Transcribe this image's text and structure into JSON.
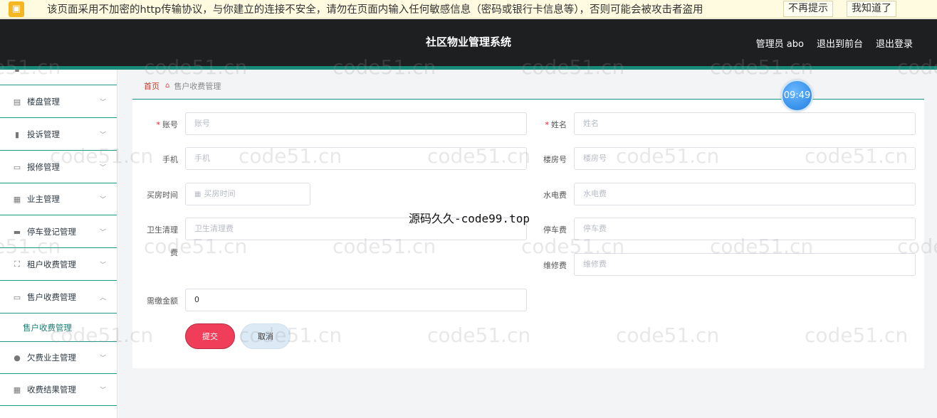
{
  "warning": {
    "text": "该页面采用不加密的http传输协议，与你建立的连接不安全，请勿在页面内输入任何敏感信息（密码或银行卡信息等），否则可能会被攻击者盗用",
    "btn_dismiss": "不再提示",
    "btn_ok": "我知道了"
  },
  "header": {
    "title": "社区物业管理系统",
    "user": "管理员 abo",
    "frontend": "退出到前台",
    "logout": "退出登录"
  },
  "timer": "09:49",
  "sidebar": {
    "items": [
      {
        "label": "楼盘管理",
        "icon": "clipboard-icon"
      },
      {
        "label": "投诉管理",
        "icon": "bar-chart-icon"
      },
      {
        "label": "报修管理",
        "icon": "chat-icon"
      },
      {
        "label": "业主管理",
        "icon": "grid-icon"
      },
      {
        "label": "停车登记管理",
        "icon": "comment-icon"
      },
      {
        "label": "租户收费管理",
        "icon": "expand-icon"
      },
      {
        "label": "售户收费管理",
        "icon": "card-icon"
      },
      {
        "label": "欠费业主管理",
        "icon": "user-icon"
      },
      {
        "label": "收费结果管理",
        "icon": "apps-icon"
      }
    ],
    "sub_item": "售户收费管理"
  },
  "breadcrumb": {
    "home": "首页",
    "current": "售户收费管理"
  },
  "form": {
    "account": {
      "label": "账号",
      "placeholder": "账号"
    },
    "name": {
      "label": "姓名",
      "placeholder": "姓名"
    },
    "phone": {
      "label": "手机",
      "placeholder": "手机"
    },
    "room": {
      "label": "楼房号",
      "placeholder": "楼房号"
    },
    "buy_time": {
      "label": "买房时间",
      "placeholder": "买房时间"
    },
    "utilities": {
      "label": "水电费",
      "placeholder": "水电费"
    },
    "sanitation": {
      "label_1": "卫生清理",
      "label_2": "费",
      "placeholder": "卫生清理费"
    },
    "parking": {
      "label": "停车费",
      "placeholder": "停车费"
    },
    "repair": {
      "label": "维修费",
      "placeholder": "维修费"
    },
    "amount": {
      "label": "需缴金额",
      "value": "0"
    },
    "submit": "提交",
    "cancel": "取消"
  },
  "overlay_text": "源码久久-code99.top",
  "watermark": "code51.cn"
}
